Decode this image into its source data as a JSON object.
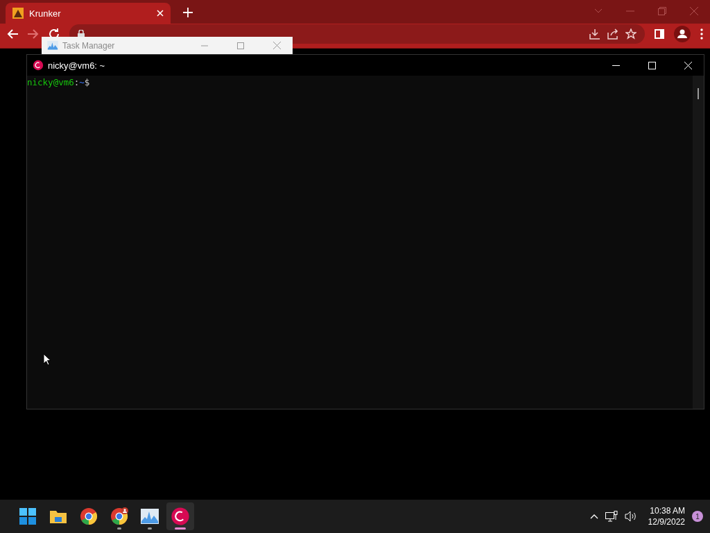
{
  "browser": {
    "tab": {
      "title": "Krunker",
      "selected": true
    }
  },
  "task_manager": {
    "title": "Task Manager"
  },
  "terminal": {
    "title": "nicky@vm6: ~",
    "prompt_user": "nicky@vm6",
    "prompt_sep": ":",
    "prompt_path": "~",
    "prompt_sign": "$"
  },
  "taskbar": {
    "apps": [
      {
        "kind": "start",
        "running": false,
        "selected": false
      },
      {
        "kind": "files",
        "running": false,
        "selected": false
      },
      {
        "kind": "chrome",
        "running": false,
        "selected": false
      },
      {
        "kind": "chrome-profile",
        "running": true,
        "selected": false
      },
      {
        "kind": "taskmgr",
        "running": true,
        "selected": false
      },
      {
        "kind": "debian",
        "running": true,
        "selected": true
      }
    ],
    "time": "10:38 AM",
    "date": "12/9/2022",
    "notifications": "1"
  }
}
